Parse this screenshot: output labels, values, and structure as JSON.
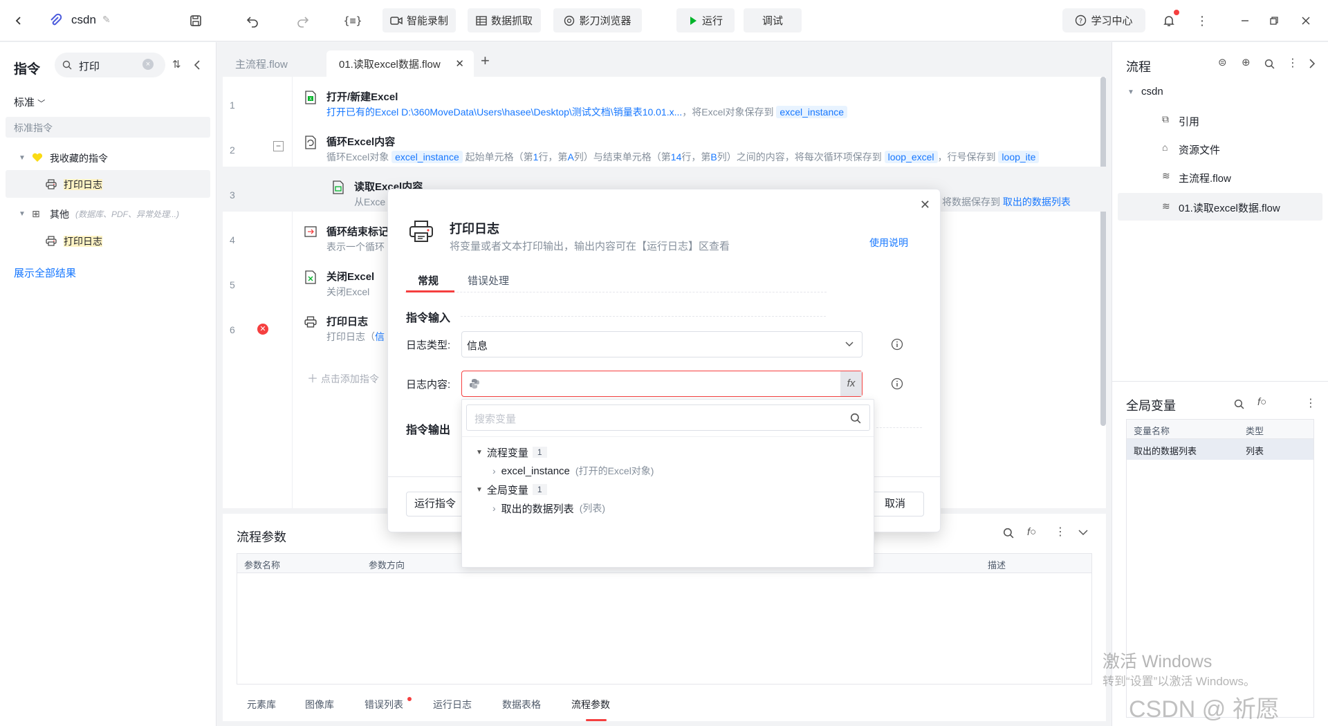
{
  "topbar": {
    "project_name": "csdn",
    "buttons": {
      "smart_record": "智能录制",
      "data_capture": "数据抓取",
      "browser": "影刀浏览器",
      "run": "运行",
      "debug": "调试",
      "learn_center": "学习中心"
    },
    "colors": {
      "run_green": "#00b42a",
      "notification_dot": "#f53f3f"
    }
  },
  "left_panel": {
    "title": "指令",
    "search_value": "打印",
    "filter": "标准",
    "section": "标准指令",
    "favorites": "我收藏的指令",
    "favorite_item": "打印日志",
    "other_group": "其他",
    "other_hint": "(数据库、PDF、异常处理...)",
    "other_item": "打印日志",
    "show_all": "展示全部结果"
  },
  "tabs": [
    {
      "label": "主流程.flow"
    },
    {
      "label": "01.读取excel数据.flow"
    }
  ],
  "steps": [
    {
      "num": "1",
      "title": "打开/新建Excel",
      "desc_link": "打开已有的Excel D:\\360MoveData\\Users\\hasee\\Desktop\\测试文档\\销量表10.01.x...",
      "desc_text": "，将Excel对象保存到",
      "var": "excel_instance"
    },
    {
      "num": "2",
      "title": "循环Excel内容",
      "d1": "循环Excel对象",
      "v1": "excel_instance",
      "d2": "起始单元格（第",
      "s1": "1",
      "d3": "行，第",
      "s2": "A",
      "d4": "列）与结束单元格（第",
      "s3": "14",
      "d5": "行，第",
      "s4": "B",
      "d6": "列）之间的内容，将每次循环项保存到",
      "v2": "loop_excel",
      "d7": "，行号保存到",
      "v3": "loop_ite"
    },
    {
      "num": "3",
      "title": "读取Excel内容",
      "desc": "从Exce",
      "desc_tail": "将数据保存到",
      "var": "取出的数据列表"
    },
    {
      "num": "4",
      "title": "循环结束标记",
      "desc": "表示一个循环"
    },
    {
      "num": "5",
      "title": "关闭Excel",
      "desc": "关闭Excel"
    },
    {
      "num": "6",
      "title": "打印日志",
      "desc": "打印日志（",
      "desc_var": "信"
    }
  ],
  "add_command": "点击添加指令",
  "bottom_panel": {
    "title": "流程参数",
    "columns": {
      "name": "参数名称",
      "direction": "参数方向",
      "desc": "描述"
    },
    "tabs": [
      "元素库",
      "图像库",
      "错误列表",
      "运行日志",
      "数据表格",
      "流程参数"
    ]
  },
  "right_panel": {
    "title": "流程",
    "tree_root": "csdn",
    "tree_items": [
      "引用",
      "资源文件",
      "主流程.flow",
      "01.读取excel数据.flow"
    ],
    "globals_title": "全局变量",
    "globals_columns": {
      "name": "变量名称",
      "type": "类型"
    },
    "globals_row": {
      "name": "取出的数据列表",
      "type": "列表"
    }
  },
  "dialog": {
    "title": "打印日志",
    "subtitle": "将变量或者文本打印输出，输出内容可在【运行日志】区查看",
    "help_link": "使用说明",
    "tab_general": "常规",
    "tab_error": "错误处理",
    "section_input": "指令输入",
    "log_type_label": "日志类型:",
    "log_type_value": "信息",
    "log_content_label": "日志内容:",
    "section_output": "指令输出",
    "run_button": "运行指令",
    "cancel_button": "取消",
    "fx_label": "fx"
  },
  "var_dropdown": {
    "search_placeholder": "搜索变量",
    "groups": [
      {
        "name": "流程变量",
        "count": "1",
        "item": "excel_instance",
        "item_type": "(打开的Excel对象)"
      },
      {
        "name": "全局变量",
        "count": "1",
        "item": "取出的数据列表",
        "item_type": "(列表)"
      }
    ]
  },
  "watermark": {
    "line1": "激活 Windows",
    "line2": "转到“设置”以激活 Windows。",
    "csdn": "CSDN @ 祈愿"
  }
}
